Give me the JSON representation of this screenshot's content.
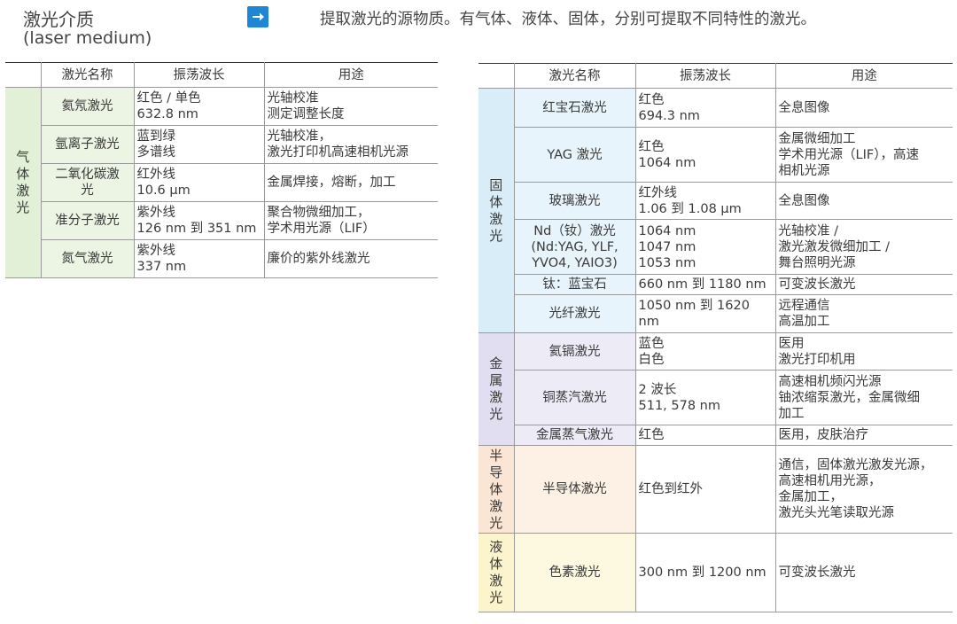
{
  "header": {
    "title_zh": "激光介质",
    "title_en": "(laser medium)",
    "description": "提取激光的源物质。有气体、液体、固体，分别可提取不同特性的激光。"
  },
  "columns": [
    "激光名称",
    "振荡波长",
    "用途"
  ],
  "gas_table": {
    "category": "气体激光",
    "rows": [
      {
        "name": "氦氖激光",
        "wavelength": [
          "红色 / 单色",
          "632.8 nm"
        ],
        "use": [
          "光轴校准",
          "测定调整长度"
        ]
      },
      {
        "name": "氩离子激光",
        "wavelength": [
          "蓝到绿",
          "多谱线"
        ],
        "use": [
          "光轴校准，",
          "激光打印机高速相机光源"
        ]
      },
      {
        "name": "二氧化碳激光",
        "wavelength": [
          "红外线",
          "10.6 μm"
        ],
        "use": [
          "金属焊接，熔断，加工"
        ]
      },
      {
        "name": "准分子激光",
        "wavelength": [
          "紫外线",
          "126 nm 到 351 nm"
        ],
        "use": [
          "聚合物微细加工，",
          "学术用光源（LIF）"
        ]
      },
      {
        "name": "氮气激光",
        "wavelength": [
          "紫外线",
          "337 nm"
        ],
        "use": [
          "廉价的紫外线激光"
        ]
      }
    ]
  },
  "right_table": {
    "groups": [
      {
        "category": "固体激光",
        "style": "solid",
        "rows": [
          {
            "name": [
              "红宝石激光"
            ],
            "wavelength": [
              "红色",
              "694.3 nm"
            ],
            "use": [
              "全息图像"
            ]
          },
          {
            "name": [
              "YAG 激光"
            ],
            "wavelength": [
              "红色",
              "1064 nm"
            ],
            "use": [
              "金属微细加工",
              "学术用光源（LIF），高速",
              "相机光源"
            ]
          },
          {
            "name": [
              "玻璃激光"
            ],
            "wavelength": [
              "红外线",
              "1.06 到 1.08 μm"
            ],
            "use": [
              "全息图像"
            ]
          },
          {
            "name": [
              "Nd（钕）激光",
              "(Nd:YAG, YLF,",
              "YVO4, YAIO3)"
            ],
            "wavelength": [
              "1064 nm",
              "1047 nm",
              "1053 nm"
            ],
            "use": [
              "光轴校准 /",
              "激光激发微细加工 /",
              "舞台照明光源"
            ]
          },
          {
            "name": [
              "钛：蓝宝石"
            ],
            "wavelength": [
              "660 nm 到 1180 nm"
            ],
            "use": [
              "可变波长激光"
            ]
          },
          {
            "name": [
              "光纤激光"
            ],
            "wavelength": [
              "1050 nm 到 1620 nm"
            ],
            "use": [
              "远程通信",
              "高温加工"
            ]
          }
        ]
      },
      {
        "category": "金属激光",
        "style": "metal",
        "rows": [
          {
            "name": [
              "氦镉激光"
            ],
            "wavelength": [
              "蓝色",
              "白色"
            ],
            "use": [
              "医用",
              "激光打印机用"
            ]
          },
          {
            "name": [
              "铜蒸汽激光"
            ],
            "wavelength": [
              "2 波长",
              "511, 578 nm"
            ],
            "use": [
              "高速相机频闪光源",
              "铀浓缩泵激光，金属微细",
              "加工"
            ]
          },
          {
            "name": [
              "金属蒸气激光"
            ],
            "wavelength": [
              "红色"
            ],
            "use": [
              "医用，皮肤治疗"
            ]
          }
        ]
      },
      {
        "category": "半导体激光",
        "style": "semi",
        "rows": [
          {
            "name": [
              "半导体激光"
            ],
            "wavelength": [
              "红色到红外"
            ],
            "use": [
              "通信，固体激光激发光源，",
              "高速相机用光源，",
              "金属加工，",
              "激光头光笔读取光源"
            ]
          }
        ]
      },
      {
        "category": "液体激光",
        "style": "liq",
        "rows": [
          {
            "name": [
              "色素激光"
            ],
            "wavelength": [
              "300 nm 到 1200 nm"
            ],
            "use": [
              "可变波长激光"
            ]
          }
        ]
      }
    ]
  }
}
